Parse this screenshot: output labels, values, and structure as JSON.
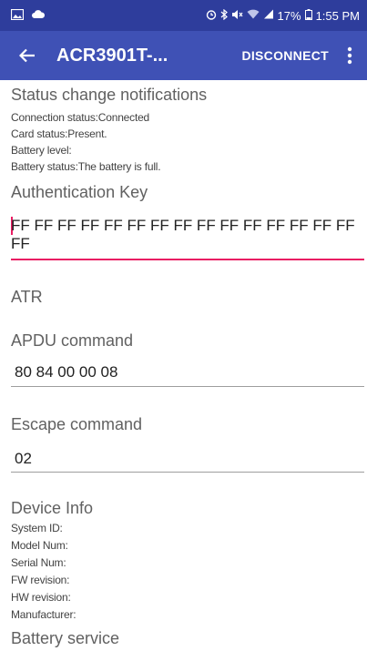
{
  "status_bar": {
    "left_icons": [
      "gallery-icon",
      "cloud-icon"
    ],
    "right_icons": [
      "alarm-icon",
      "bluetooth-icon",
      "mute-icon",
      "wifi-icon",
      "signal-icon"
    ],
    "battery": "17%",
    "time": "1:55 PM"
  },
  "app_bar": {
    "title": "ACR3901T-...",
    "disconnect_label": "DISCONNECT",
    "colors": {
      "status_bar": "#2e3d9c",
      "app_bar": "#3f51b5",
      "accent": "#e91e63"
    }
  },
  "status_section": {
    "title": "Status change notifications",
    "lines": [
      "Connection status:Connected",
      "Card status:Present.",
      "Battery level:",
      "Battery status:The battery is full."
    ]
  },
  "auth_key": {
    "label": "Authentication Key",
    "value": "FF FF FF FF FF FF FF FF FF FF FF FF FF FF FF FF"
  },
  "atr": {
    "label": "ATR"
  },
  "apdu": {
    "label": "APDU command",
    "value": "80 84 00 00 08"
  },
  "escape": {
    "label": "Escape command",
    "value": "02"
  },
  "device_info": {
    "title": "Device Info",
    "lines": [
      "System ID:",
      "Model Num:",
      "Serial Num:",
      "FW revision:",
      "HW revision:",
      "Manufacturer:"
    ]
  },
  "battery_service": {
    "title": "Battery service"
  }
}
